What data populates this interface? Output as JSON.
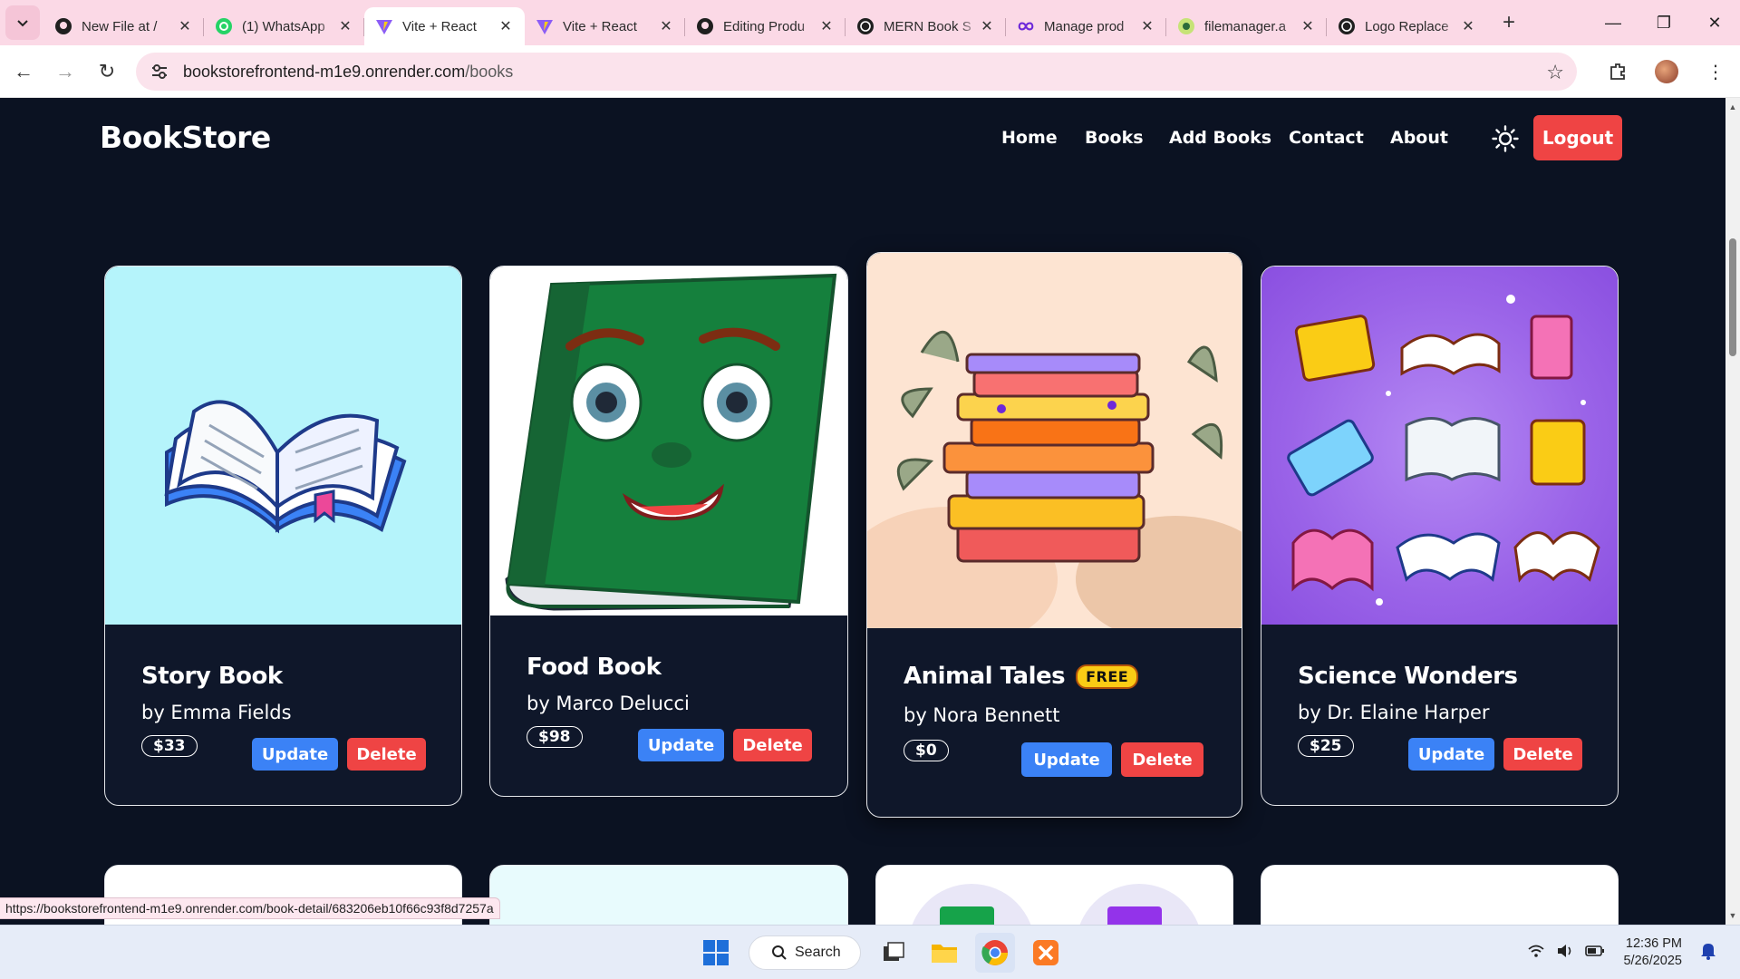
{
  "browser": {
    "tabs": [
      {
        "title": "New File at /",
        "icon": "github-icon"
      },
      {
        "title": "(1) WhatsApp",
        "icon": "whatsapp-icon"
      },
      {
        "title": "Vite + React",
        "icon": "vite-icon",
        "active": true
      },
      {
        "title": "Vite + React",
        "icon": "vite-icon"
      },
      {
        "title": "Editing Produ",
        "icon": "github-icon"
      },
      {
        "title": "MERN Book S",
        "icon": "openai-icon"
      },
      {
        "title": "Manage prod",
        "icon": "infinity-icon"
      },
      {
        "title": "filemanager.a",
        "icon": "file-icon"
      },
      {
        "title": "Logo Replace",
        "icon": "openai-icon"
      }
    ],
    "url_host": "bookstorefrontend-m1e9.onrender.com",
    "url_path": "/books",
    "status_url": "https://bookstorefrontend-m1e9.onrender.com/book-detail/683206eb10f66c93f8d7257a"
  },
  "site": {
    "logo": "BookStore",
    "nav": [
      "Home",
      "Books",
      "Add Books",
      "Contact",
      "About"
    ],
    "logout_label": "Logout"
  },
  "books": [
    {
      "title": "Story Book",
      "author": "by Emma Fields",
      "price": "$33",
      "update": "Update",
      "delete": "Delete",
      "badge": ""
    },
    {
      "title": "Food Book",
      "author": "by Marco Delucci",
      "price": "$98",
      "update": "Update",
      "delete": "Delete",
      "badge": ""
    },
    {
      "title": "Animal Tales",
      "author": "by Nora Bennett",
      "price": "$0",
      "update": "Update",
      "delete": "Delete",
      "badge": "FREE"
    },
    {
      "title": "Science Wonders",
      "author": "by Dr. Elaine Harper",
      "price": "$25",
      "update": "Update",
      "delete": "Delete",
      "badge": ""
    }
  ],
  "taskbar": {
    "search_label": "Search",
    "time": "12:36 PM",
    "date": "5/26/2025"
  },
  "colors": {
    "page_bg": "#0b1222",
    "update_btn": "#3b82f6",
    "delete_btn": "#ef4444",
    "free_badge": "#facc15"
  }
}
